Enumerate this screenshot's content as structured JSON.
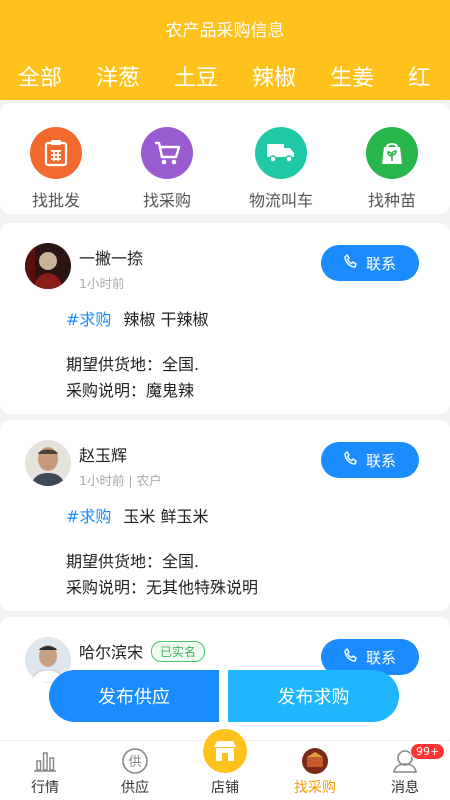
{
  "header": {
    "title": "农产品采购信息",
    "tabs": [
      "全部",
      "洋葱",
      "土豆",
      "辣椒",
      "生姜",
      "红"
    ],
    "active_tab": 0
  },
  "quick_actions": [
    {
      "label": "找批发",
      "icon": "wholesale-list-icon",
      "color": "#f26a2e"
    },
    {
      "label": "找采购",
      "icon": "shopping-cart-icon",
      "color": "#9a5bd0"
    },
    {
      "label": "物流叫车",
      "icon": "truck-icon",
      "color": "#1fc9a5"
    },
    {
      "label": "找种苗",
      "icon": "seedling-bag-icon",
      "color": "#28b54c"
    }
  ],
  "posts": [
    {
      "name": "一撇一捺",
      "time": "1小时前",
      "verified": "",
      "tag": "#求购",
      "products": "辣椒 干辣椒",
      "supply": "期望供货地：全国.",
      "note": "采购说明：魔鬼辣",
      "contact": "联系"
    },
    {
      "name": "赵玉辉",
      "time": "1小时前 | 农户",
      "verified": "",
      "tag": "#求购",
      "products": "玉米 鲜玉米",
      "supply": "期望供货地：全国.",
      "note": "采购说明：无其他特殊说明",
      "contact": "联系"
    },
    {
      "name": "哈尔滨宋",
      "time": "",
      "verified": "已实名",
      "tag": "",
      "products": "",
      "supply": "",
      "note": "",
      "contact": "联系"
    }
  ],
  "fab": {
    "left": "发布供应",
    "right": "发布求购"
  },
  "tabbar": {
    "items": [
      {
        "label": "行情",
        "icon": "bar-chart-icon"
      },
      {
        "label": "供应",
        "icon": "supply-circle-icon"
      },
      {
        "label": "店铺",
        "icon": "shop-icon"
      },
      {
        "label": "找采购",
        "icon": "avatar-icon"
      },
      {
        "label": "消息",
        "icon": "message-icon"
      }
    ],
    "active": 3,
    "badge": "99+"
  },
  "colors": {
    "brand": "#ffc21c",
    "accent": "#1a8cff",
    "active_tab": "#ff9900"
  }
}
